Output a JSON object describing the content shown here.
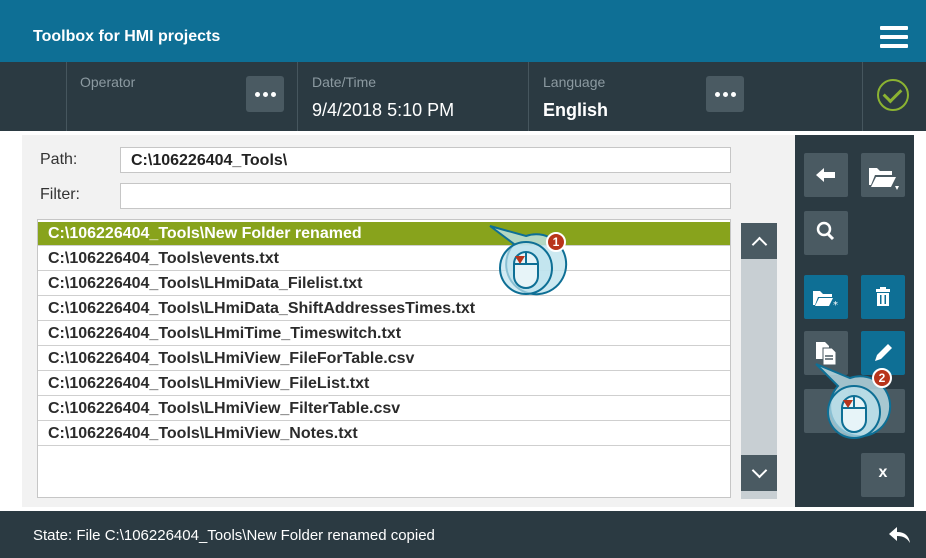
{
  "app": {
    "title": "Toolbox for HMI projects"
  },
  "header": {
    "operator": {
      "caption": "Operator",
      "value": ""
    },
    "datetime": {
      "caption": "Date/Time",
      "value": "9/4/2018 5:10 PM"
    },
    "language": {
      "caption": "Language",
      "value": "English"
    }
  },
  "form": {
    "path_label": "Path:",
    "path_value": "C:\\106226404_Tools\\",
    "filter_label": "Filter:",
    "filter_value": ""
  },
  "files": [
    "C:\\106226404_Tools\\New Folder renamed",
    "C:\\106226404_Tools\\events.txt",
    "C:\\106226404_Tools\\LHmiData_Filelist.txt",
    "C:\\106226404_Tools\\LHmiData_ShiftAddressesTimes.txt",
    "C:\\106226404_Tools\\LHmiTime_Timeswitch.txt",
    "C:\\106226404_Tools\\LHmiView_FileForTable.csv",
    "C:\\106226404_Tools\\LHmiView_FileList.txt",
    "C:\\106226404_Tools\\LHmiView_FilterTable.csv",
    "C:\\106226404_Tools\\LHmiView_Notes.txt"
  ],
  "selected_index": 0,
  "toolbar": {
    "close_label": "x"
  },
  "callouts": [
    "1",
    "2"
  ],
  "status": {
    "text": "State: File C:\\106226404_Tools\\New Folder renamed copied"
  },
  "colors": {
    "title_bar": "#0e6f95",
    "header_bg": "#2b3a42",
    "selected_row": "#88a31c",
    "accent_blue": "#0e6f95",
    "status_ok": "#8bb332",
    "callout_badge": "#b8341b"
  },
  "icons": {
    "menu": "hamburger-menu-icon",
    "status": "check-circle-icon",
    "back": "back-arrow-icon",
    "toolbar": [
      "arrow-left-icon",
      "folder-open-icon",
      "search-icon",
      "new-folder-icon",
      "trash-icon",
      "copy-document-icon",
      "pencil-icon",
      "close-icon"
    ]
  }
}
